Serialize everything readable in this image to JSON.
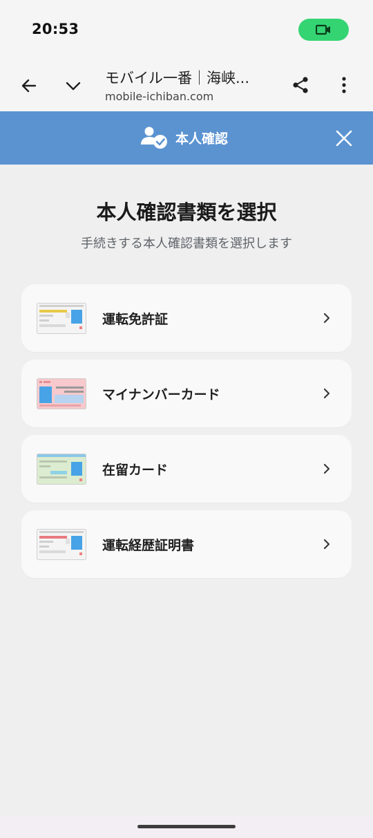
{
  "status_bar": {
    "time": "20:53",
    "record_icon": "video-camera-icon",
    "pill_color": "#35d473"
  },
  "browser": {
    "title": "モバイル一番｜海峡...",
    "url": "mobile-ichiban.com",
    "icons": {
      "back": "arrow-left-icon",
      "expand": "chevron-down-icon",
      "share": "share-icon",
      "menu": "more-vert-icon"
    }
  },
  "kyc_header": {
    "title": "本人確認",
    "icon": "person-check-icon",
    "close_icon": "close-icon",
    "color": "#5b93d1"
  },
  "main": {
    "heading": "本人確認書類を選択",
    "subheading": "手続きする本人確認書類を選択します",
    "documents": [
      {
        "label": "運転免許証",
        "thumb_icon": "drivers-license-icon",
        "accent": "#e8c94a"
      },
      {
        "label": "マイナンバーカード",
        "thumb_icon": "my-number-card-icon",
        "accent": "#f7c9cc"
      },
      {
        "label": "在留カード",
        "thumb_icon": "residence-card-icon",
        "accent": "#a8d6b0"
      },
      {
        "label": "運転経歴証明書",
        "thumb_icon": "driving-record-certificate-icon",
        "accent": "#e87a80"
      }
    ]
  }
}
